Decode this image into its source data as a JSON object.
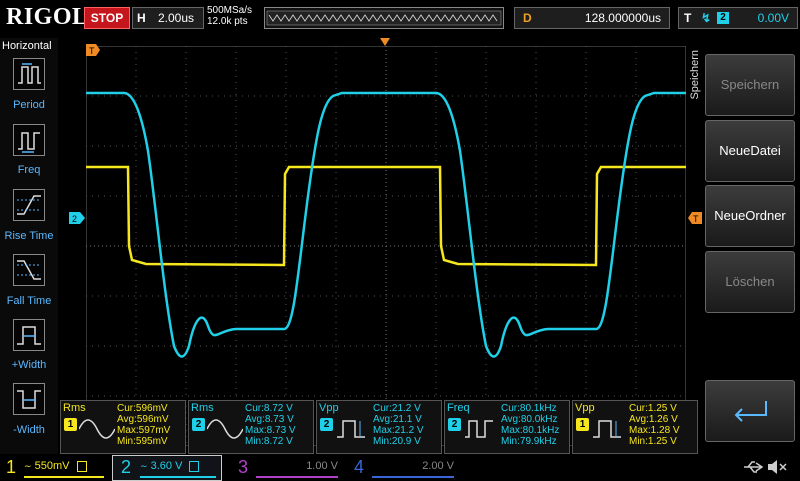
{
  "app": {
    "brand": "RIGOL",
    "run_state": "STOP"
  },
  "timebase": {
    "label": "H",
    "value": "2.00us",
    "sample_rate": "500MSa/s",
    "points": "12.0k pts"
  },
  "delay": {
    "label": "D",
    "value": "128.000000us"
  },
  "trigger": {
    "label": "T",
    "edge_icon": "rising-edge-icon",
    "source": "2",
    "level": "0.00V"
  },
  "left_menu": {
    "title": "Horizontal",
    "items": [
      {
        "label": "Period",
        "icon": "period-icon"
      },
      {
        "label": "Freq",
        "icon": "frequency-icon"
      },
      {
        "label": "Rise Time",
        "icon": "rise-time-icon"
      },
      {
        "label": "Fall Time",
        "icon": "fall-time-icon"
      },
      {
        "label": "+Width",
        "icon": "positive-width-icon"
      },
      {
        "label": "-Width",
        "icon": "negative-width-icon"
      }
    ]
  },
  "right_menu": {
    "title": "Speichern",
    "buttons": [
      {
        "label": "Speichern",
        "enabled": false
      },
      {
        "label": "NeueDatei",
        "enabled": true
      },
      {
        "label": "NeueOrdner",
        "enabled": true
      },
      {
        "label": "Löschen",
        "enabled": false
      },
      {
        "label": "",
        "icon": "enter-return-icon",
        "enabled": true
      }
    ]
  },
  "measurements": [
    {
      "name": "Rms",
      "channel": "1",
      "cur": "Cur:596mV",
      "avg": "Avg:596mV",
      "max": "Max:597mV",
      "min": "Min:595mV"
    },
    {
      "name": "Rms",
      "channel": "2",
      "cur": "Cur:8.72 V",
      "avg": "Avg:8.73 V",
      "max": "Max:8.73 V",
      "min": "Min:8.72 V"
    },
    {
      "name": "Vpp",
      "channel": "2",
      "cur": "Cur:21.2 V",
      "avg": "Avg:21.1 V",
      "max": "Max:21.2 V",
      "min": "Min:20.9 V"
    },
    {
      "name": "Freq",
      "channel": "2",
      "cur": "Cur:80.1kHz",
      "avg": "Avg:80.0kHz",
      "max": "Max:80.1kHz",
      "min": "Min:79.9kHz"
    },
    {
      "name": "Vpp",
      "channel": "1",
      "cur": "Cur:1.25 V",
      "avg": "Avg:1.26 V",
      "max": "Max:1.28 V",
      "min": "Min:1.25 V"
    }
  ],
  "channels": [
    {
      "num": "1",
      "scale": "550mV",
      "color": "#f5e61e"
    },
    {
      "num": "2",
      "scale": "3.60 V",
      "color": "#20d0e8"
    },
    {
      "num": "3",
      "scale": "1.00 V",
      "color": "#b040c8"
    },
    {
      "num": "4",
      "scale": "2.00 V",
      "color": "#3a64d8"
    }
  ],
  "colors": {
    "ch1": "#f5e61e",
    "ch2": "#20d0e8",
    "trigger_marker": "#f08a24",
    "stop": "#c4161c"
  },
  "status_icons": [
    "usb-icon",
    "mute-icon"
  ]
}
